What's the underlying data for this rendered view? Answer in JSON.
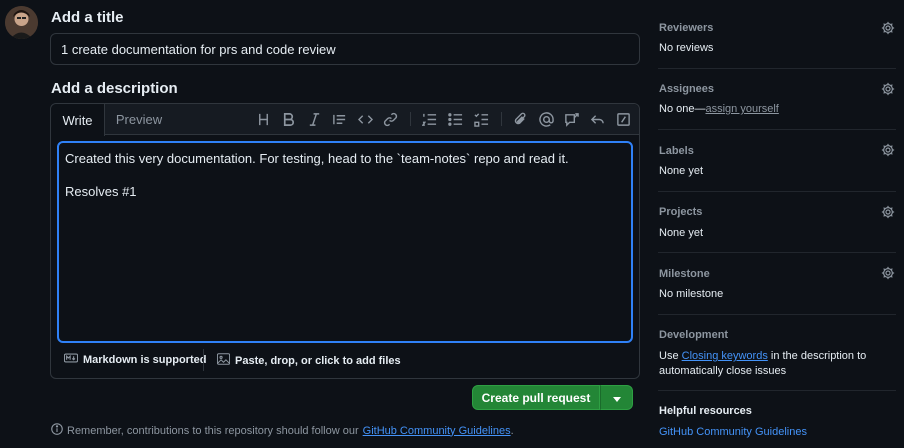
{
  "form": {
    "title_heading": "Add a title",
    "title_value": "1 create documentation for prs and code review",
    "desc_heading": "Add a description",
    "tabs": {
      "write": "Write",
      "preview": "Preview"
    },
    "body_line1": "Created this very documentation. For testing, head to the `team-notes` repo and read it.",
    "body_line2": "Resolves #1",
    "markdown_label": "Markdown is supported",
    "files_label": "Paste, drop, or click to add files",
    "create_label": "Create pull request",
    "notice_text": "Remember, contributions to this repository should follow our",
    "notice_link": "GitHub Community Guidelines",
    "notice_end": "."
  },
  "toolbar": [
    "heading-icon",
    "bold-icon",
    "italic-icon",
    "quote-icon",
    "code-icon",
    "link-icon",
    "ordered-list-icon",
    "unordered-list-icon",
    "task-list-icon",
    "attach-icon",
    "mention-icon",
    "reference-icon",
    "undo-icon",
    "slash-command-icon"
  ],
  "sidebar": {
    "reviewers": {
      "label": "Reviewers",
      "value": "No reviews"
    },
    "assignees": {
      "label": "Assignees",
      "value_prefix": "No one—",
      "value_link": "assign yourself"
    },
    "labels": {
      "label": "Labels",
      "value": "None yet"
    },
    "projects": {
      "label": "Projects",
      "value": "None yet"
    },
    "milestone": {
      "label": "Milestone",
      "value": "No milestone"
    },
    "development": {
      "label": "Development",
      "prefix": "Use ",
      "link": "Closing keywords",
      "suffix": " in the description to",
      "line2": "automatically close issues"
    },
    "helpful": {
      "label": "Helpful resources",
      "link": "GitHub Community Guidelines"
    }
  },
  "colors": {
    "accent": "#2f81f7",
    "button": "#238636",
    "link": "#4493f8"
  }
}
